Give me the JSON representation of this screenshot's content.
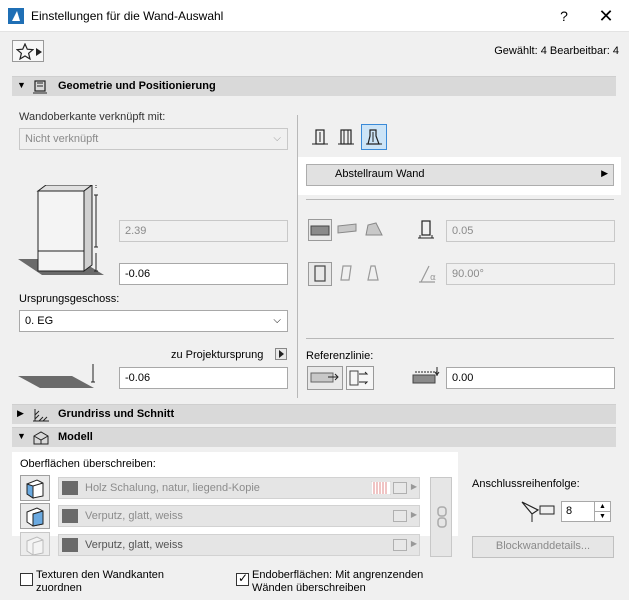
{
  "window": {
    "title": "Einstellungen für die Wand-Auswahl",
    "help": "?",
    "close": "✕"
  },
  "header": {
    "selected_info": "Gewählt: 4 Bearbeitbar: 4"
  },
  "sections": {
    "geometry": "Geometrie und Positionierung",
    "floorplan": "Grundriss und Schnitt",
    "model": "Modell"
  },
  "geometry": {
    "top_linked_label": "Wandoberkante verknüpft mit:",
    "top_linked_value": "Nicht verknüpft",
    "height_value": "2.39",
    "bottom_offset_value": "-0.06",
    "home_story_label": "Ursprungsgeschoss:",
    "home_story_value": "0. EG",
    "to_project_zero_label": "zu Projektursprung",
    "project_zero_value": "-0.06",
    "abstell_label": "Abstellraum Wand",
    "thickness_value": "0.05",
    "angle_value": "90.00°",
    "reference_line_label": "Referenzlinie:",
    "reference_offset_value": "0.00"
  },
  "model": {
    "override_label": "Oberflächen überschreiben:",
    "surfaces": [
      {
        "name": "Holz Schalung, natur, liegend-Kopie"
      },
      {
        "name": "Verputz, glatt, weiss"
      },
      {
        "name": "Verputz, glatt, weiss"
      }
    ],
    "connection_order_label": "Anschlussreihenfolge:",
    "connection_order_value": "8",
    "block_details_label": "Blockwanddetails...",
    "textures_label_line1": "Texturen den Wandkanten",
    "textures_label_line2": "zuordnen",
    "textures_checked": false,
    "end_surfaces_label_line1": "Endoberflächen: Mit angrenzenden",
    "end_surfaces_label_line2": "Wänden überschreiben",
    "end_surfaces_checked": true
  },
  "colors": {
    "section_bg": "#d9d9d9",
    "selected_blue": "#cce4f7",
    "selected_border": "#3a8ad8"
  }
}
